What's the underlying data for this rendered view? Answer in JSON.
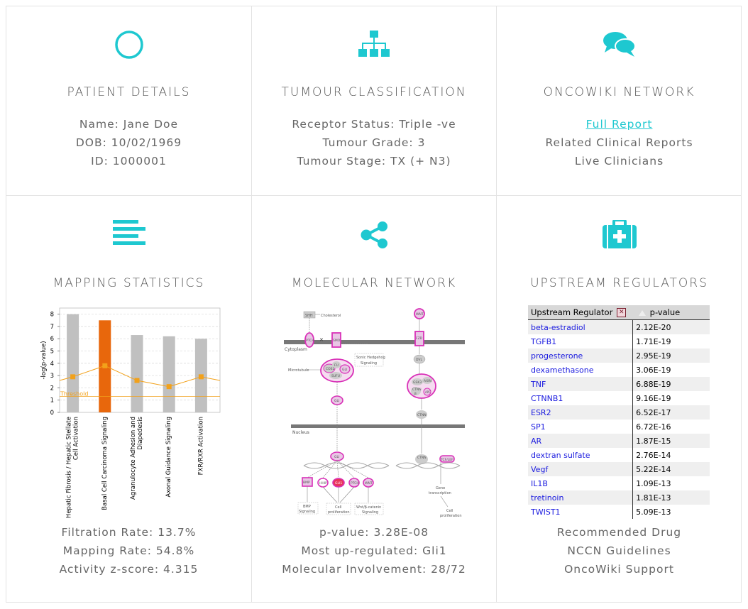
{
  "colors": {
    "accent": "#1ec8d0",
    "bar_gray": "#c0c0c0",
    "bar_orange": "#e8670c",
    "line_orange": "#f2a11a",
    "magenta": "#d931b8"
  },
  "patient": {
    "icon": "circle-icon",
    "title": "PATIENT DETAILS",
    "name": "Name: Jane Doe",
    "dob": "DOB: 10/02/1969",
    "id": "ID: 1000001"
  },
  "tumour": {
    "icon": "sitemap-icon",
    "title": "TUMOUR CLASSIFICATION",
    "receptor": "Receptor Status: Triple -ve",
    "grade": "Tumour Grade: 3",
    "stage": "Tumour Stage: TX (+ N3)"
  },
  "oncowiki": {
    "icon": "chat-bubbles-icon",
    "title": "ONCOWIKI NETWORK",
    "full_report": "Full Report",
    "related": "Related Clinical Reports",
    "clinicians": "Live Clinicians"
  },
  "mapping": {
    "icon": "list-lines-icon",
    "title": "MAPPING STATISTICS",
    "filtration": "Filtration Rate: 13.7%",
    "mapping_rate": "Mapping Rate: 54.8%",
    "zscore": "Activity z-score: 4.315"
  },
  "network": {
    "icon": "share-icon",
    "title": "MOLECULAR NETWORK",
    "pvalue": "p-value: 3.28E-08",
    "upregulated": "Most up-regulated: Gli1",
    "involvement": "Molecular Involvement: 28/72",
    "labels": {
      "shh": "SHH",
      "cholesterol": "Cholesterol",
      "wnt_top": "WNT",
      "fzd": "FZD",
      "ptch": "PTCH",
      "smo": "SMO",
      "cytoplasm": "Cytoplasm",
      "sonic": "Sonic Hedgehog",
      "signaling": "Signaling",
      "microtubule": "Microtubule",
      "cos2": "COS2",
      "fu": "FU",
      "gli_complex": "GLI",
      "sufu": "SUFU",
      "dvl": "DVL",
      "gsk": "GSK3",
      "axin": "AXIN",
      "ctnn_beta": "CTNN",
      "beta": "β",
      "apc": "APC",
      "gli_mid": "GLI",
      "ctnn_free": "CTNN",
      "nucleus": "Nucleus",
      "gli_nuc": "GLI",
      "ctnn_nuc": "CTNN",
      "tcf": "TCF/LEF",
      "bmp": "BMP",
      "hhip": "HHIP",
      "gli1": "GLI1",
      "ptch_n": "PTCH",
      "wnt_n": "WNT",
      "bmp_sig": "BMP",
      "cell_prolif": "Cell",
      "proliferation": "proliferation",
      "wnt_sig": "Wnt/β-catenin",
      "gene": "Gene",
      "transcription": "transcription",
      "cell2": "Cell",
      "prolif2": "proliferation"
    }
  },
  "upstream": {
    "icon": "medkit-icon",
    "title": "UPSTREAM REGULATORS",
    "table": {
      "header_regulator": "Upstream Regulator",
      "header_close": "✕",
      "header_pvalue": "p-value",
      "rows": [
        {
          "name": "beta-estradiol",
          "p": "2.12E-20"
        },
        {
          "name": "TGFB1",
          "p": "1.71E-19"
        },
        {
          "name": "progesterone",
          "p": "2.95E-19"
        },
        {
          "name": "dexamethasone",
          "p": "3.06E-19"
        },
        {
          "name": "TNF",
          "p": "6.88E-19"
        },
        {
          "name": "CTNNB1",
          "p": "9.16E-19"
        },
        {
          "name": "ESR2",
          "p": "6.52E-17"
        },
        {
          "name": "SP1",
          "p": "6.72E-16"
        },
        {
          "name": "AR",
          "p": "1.87E-15"
        },
        {
          "name": "dextran sulfate",
          "p": "2.76E-14"
        },
        {
          "name": "Vegf",
          "p": "5.22E-14"
        },
        {
          "name": "IL1B",
          "p": "1.09E-13"
        },
        {
          "name": "tretinoin",
          "p": "1.81E-13"
        },
        {
          "name": "TWIST1",
          "p": "5.09E-13"
        }
      ]
    },
    "recommended": "Recommended Drug",
    "nccn": "NCCN Guidelines",
    "support": "OncoWiki Support"
  },
  "chart_data": {
    "type": "bar",
    "categories": [
      "Hepatic Fibrosis / Hepatic Stellate Cell Activation",
      "Basal Cell Carcinoma Signaling",
      "Agranulocyte Adhesion and Diapedesis",
      "Axonal Guidance Signaling",
      "FXR/RXR Activation"
    ],
    "category_lines": [
      [
        "Hepatic Fibrosis / Hepatic Stellate",
        "Cell Activation"
      ],
      [
        "Basal Cell Carcinoma Signaling"
      ],
      [
        "Agranulocyte Adhesion and",
        "Diapedesis"
      ],
      [
        "Axonal Guidance Signaling"
      ],
      [
        "FXR/RXR Activation"
      ]
    ],
    "values": [
      8.0,
      7.5,
      6.3,
      6.2,
      6.0
    ],
    "highlight_index": 1,
    "ratio_values": [
      2.9,
      3.8,
      2.6,
      2.1,
      2.9
    ],
    "ratio_end": 2.6,
    "threshold": 1.3,
    "threshold_label": "Threshold",
    "ylabel": "-log(p-value)",
    "ylim": [
      0,
      8.5
    ],
    "yticks": [
      0,
      1,
      2,
      3,
      4,
      5,
      6,
      7,
      8
    ],
    "grid": true
  }
}
